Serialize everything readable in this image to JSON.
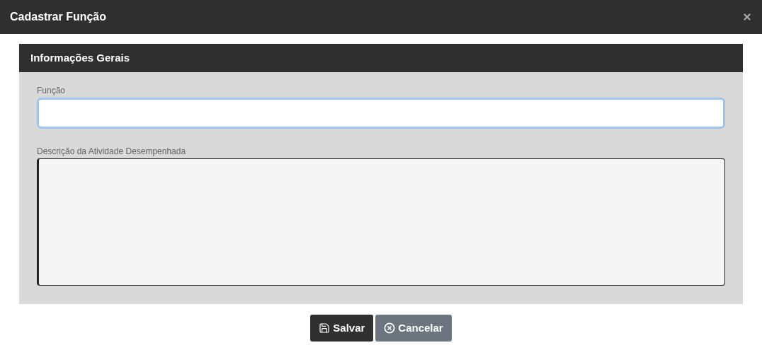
{
  "window": {
    "title": "Cadastrar Função"
  },
  "section": {
    "title": "Informações Gerais",
    "fields": [
      {
        "kind": "input",
        "label": "Função",
        "focused": true
      },
      {
        "kind": "textarea",
        "label": "Descrição da Atividade Desempenhada",
        "focused": false
      }
    ]
  },
  "buttons": [
    {
      "kind": "save",
      "label": "Salvar"
    },
    {
      "kind": "cancel",
      "label": "Cancelar"
    }
  ]
}
